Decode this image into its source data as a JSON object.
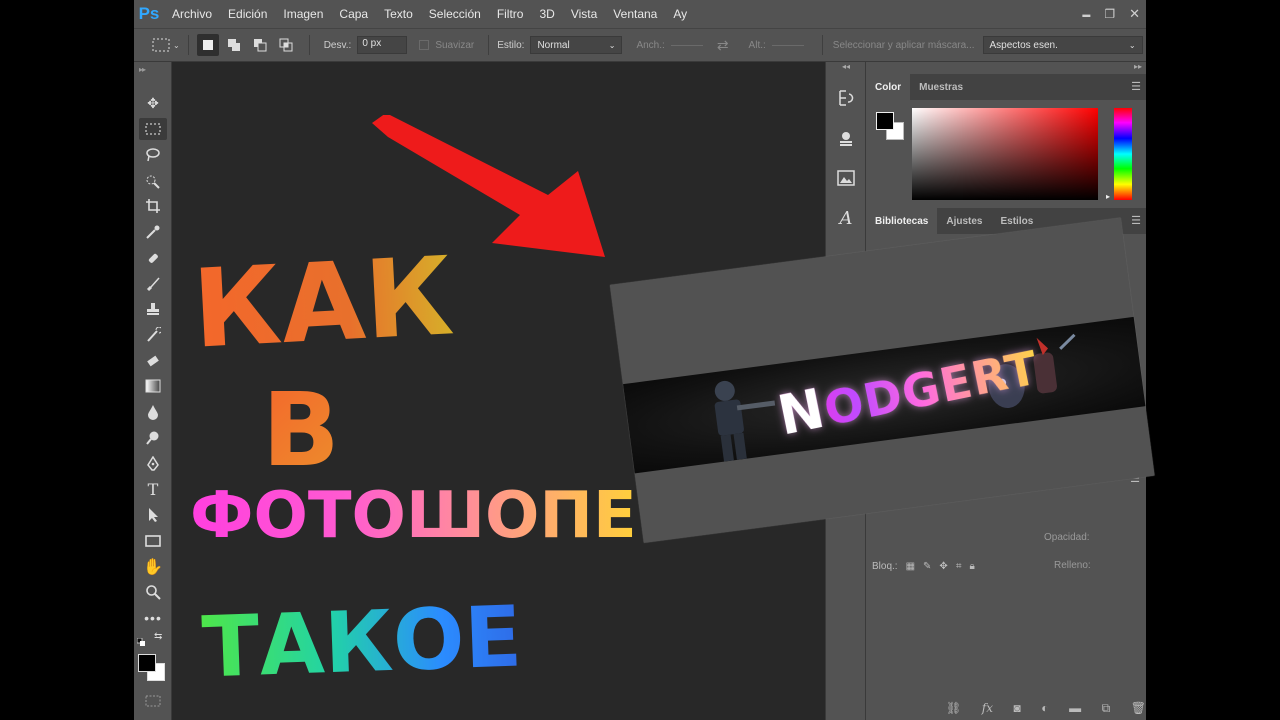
{
  "app": {
    "logo": "Ps",
    "menu": [
      "Archivo",
      "Edición",
      "Imagen",
      "Capa",
      "Texto",
      "Selección",
      "Filtro",
      "3D",
      "Vista",
      "Ventana",
      "Ay"
    ]
  },
  "window_controls": {
    "minimize": "▬",
    "restore": "❐",
    "close": "✕"
  },
  "options": {
    "feather_label": "Desv.:",
    "feather_value": "0 px",
    "antialias_label": "Suavizar",
    "style_label": "Estilo:",
    "style_value": "Normal",
    "width_label": "Anch.:",
    "height_label": "Alt.:",
    "select_mask_label": "Seleccionar y aplicar máscara...",
    "workspace_value": "Aspectos esen."
  },
  "panels": {
    "color_tabs": [
      "Color",
      "Muestras"
    ],
    "library_tabs": [
      "Bibliotecas",
      "Ajustes",
      "Estilos"
    ],
    "opacity_label": "Opacidad:",
    "lock_label": "Bloq.:",
    "fill_label": "Relleno:"
  },
  "thumbnail": {
    "banner_text": "NODGERT",
    "banner_lead": "N",
    "banner_rest": "ODGERT"
  },
  "overlay_text": {
    "line1": "КАК",
    "line2": "В",
    "line3": "ФОТОШОПЕ",
    "line4": "ТАКОЕ"
  },
  "colors": {
    "arrow": "#ee1b1b",
    "accent_blue": "#31a8ff",
    "ui_panel": "#535353",
    "canvas_bg": "#282828"
  }
}
